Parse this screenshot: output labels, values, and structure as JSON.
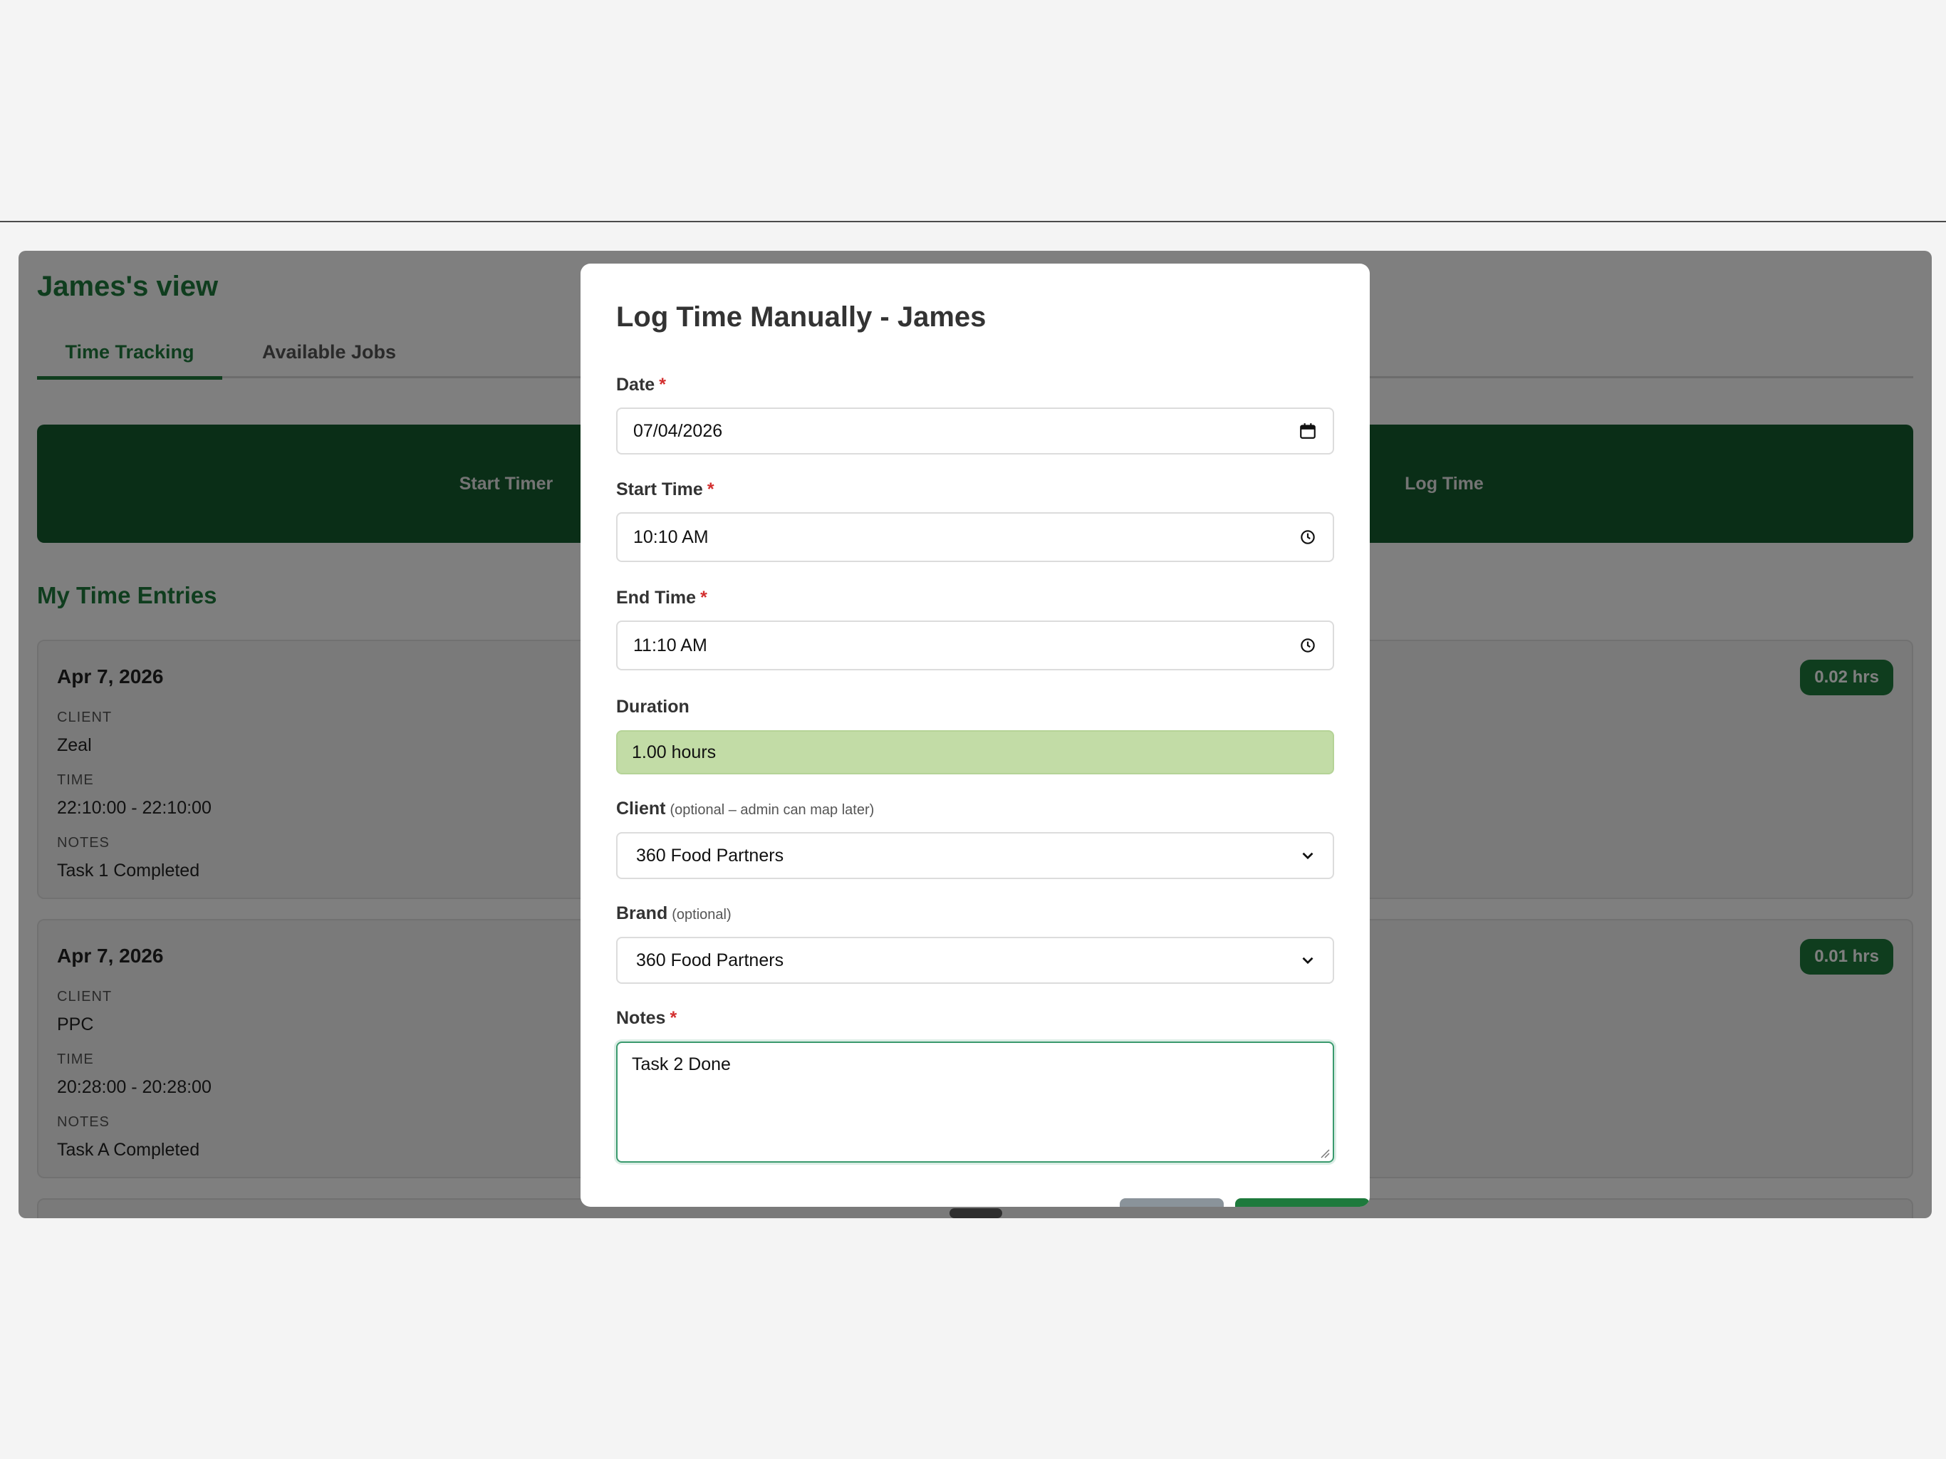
{
  "page": {
    "view_title": "James's view",
    "tabs": [
      {
        "label": "Time Tracking",
        "active": true
      },
      {
        "label": "Available Jobs",
        "active": false
      }
    ],
    "actions": {
      "start_timer": "Start Timer",
      "log_time": "Log Time"
    },
    "entries_title": "My Time Entries",
    "field_labels": {
      "client": "CLIENT",
      "time": "TIME",
      "notes": "NOTES"
    },
    "entries": [
      {
        "date": "Apr 7, 2026",
        "hours": "0.02 hrs",
        "client": "Zeal",
        "time": "22:10:00 - 22:10:00",
        "notes": "Task 1 Completed"
      },
      {
        "date": "Apr 7, 2026",
        "hours": "0.01 hrs",
        "client": "PPC",
        "time": "20:28:00 - 20:28:00",
        "notes": "Task A Completed"
      }
    ]
  },
  "modal": {
    "title": "Log Time Manually - James",
    "required_mark": "*",
    "date": {
      "label": "Date",
      "value": "07/04/2026"
    },
    "start_time": {
      "label": "Start Time",
      "value": "10:10  AM"
    },
    "end_time": {
      "label": "End Time",
      "value": "11:10  AM"
    },
    "duration": {
      "label": "Duration",
      "value": "1.00 hours"
    },
    "client": {
      "label": "Client",
      "hint": "(optional – admin can map later)",
      "value": "360 Food Partners"
    },
    "brand": {
      "label": "Brand",
      "hint": "(optional)",
      "value": "360 Food Partners"
    },
    "notes": {
      "label": "Notes",
      "value": "Task 2 Done"
    }
  },
  "colors": {
    "brand_green": "#1e7a3c",
    "action_bar": "#145c2e",
    "duration_fill": "#c2dca6",
    "required": "#d32f2f"
  },
  "icons": {
    "date": "calendar-icon",
    "time": "clock-icon",
    "select": "chevron-down-icon"
  }
}
